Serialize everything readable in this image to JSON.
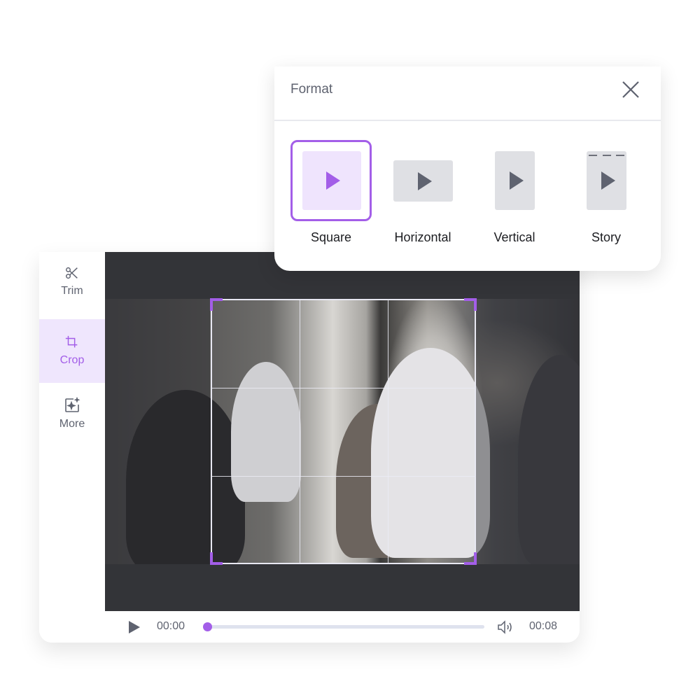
{
  "sidebar": {
    "items": [
      {
        "label": "Trim",
        "icon": "scissors-icon",
        "active": false
      },
      {
        "label": "Crop",
        "icon": "crop-icon",
        "active": true
      },
      {
        "label": "More",
        "icon": "sparkle-icon",
        "active": false
      }
    ]
  },
  "player": {
    "time_current": "00:00",
    "time_total": "00:08",
    "progress": 0,
    "play_icon": "play-icon",
    "volume_icon": "volume-icon"
  },
  "crop": {
    "aspect": "Square",
    "grid": "3x3"
  },
  "format_popup": {
    "title": "Format",
    "close_icon": "close-icon",
    "options": [
      {
        "label": "Square",
        "selected": true
      },
      {
        "label": "Horizontal",
        "selected": false
      },
      {
        "label": "Vertical",
        "selected": false
      },
      {
        "label": "Story",
        "selected": false
      }
    ]
  },
  "colors": {
    "accent": "#a35ee8",
    "accent_light": "#efe4fd",
    "video_bg": "#333438",
    "text_muted": "#5f6370"
  }
}
